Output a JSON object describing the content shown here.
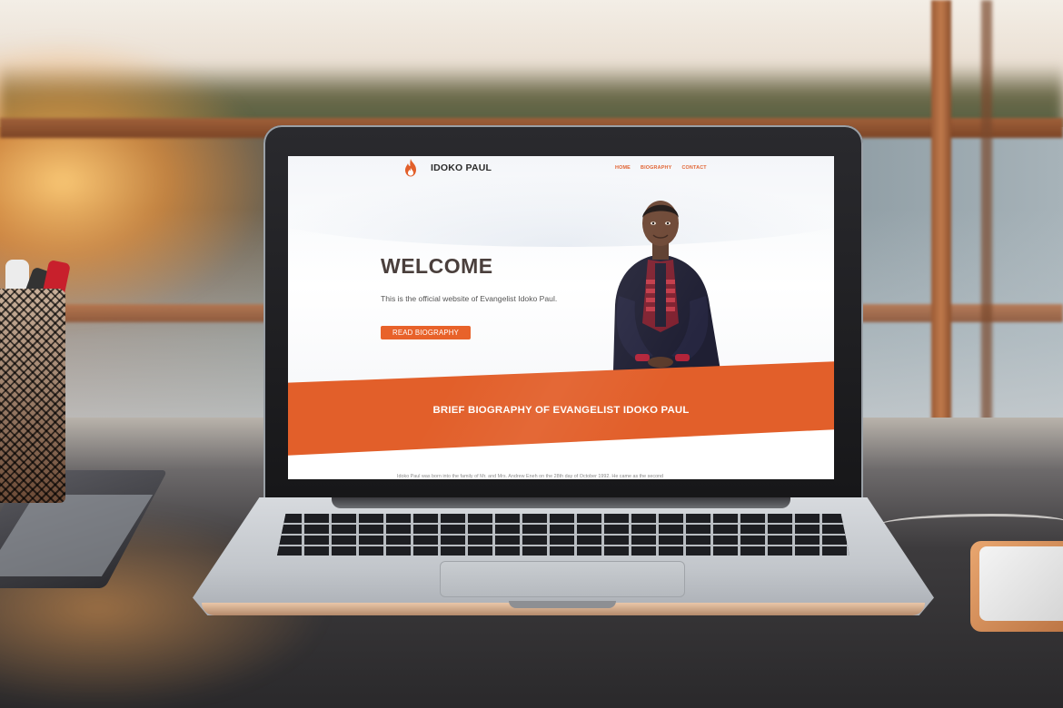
{
  "site": {
    "brand": "IDOKO PAUL",
    "logo_icon": "flame-icon",
    "nav": [
      {
        "label": "HOME"
      },
      {
        "label": "BIOGRAPHY"
      },
      {
        "label": "CONTACT"
      }
    ]
  },
  "hero": {
    "heading": "WELCOME",
    "tagline": "This is the official website of Evangelist Idoko Paul.",
    "cta_label": "READ BIOGRAPHY"
  },
  "biography": {
    "title": "BRIEF BIOGRAPHY OF EVANGELIST IDOKO PAUL",
    "intro": "Idoko Paul was born into the family of Mr. and Mrs. Andrew Eneh on the 28th day of October 1992. He came as the second"
  },
  "colors": {
    "accent": "#e25f2a",
    "heading": "#4a3f3c"
  }
}
